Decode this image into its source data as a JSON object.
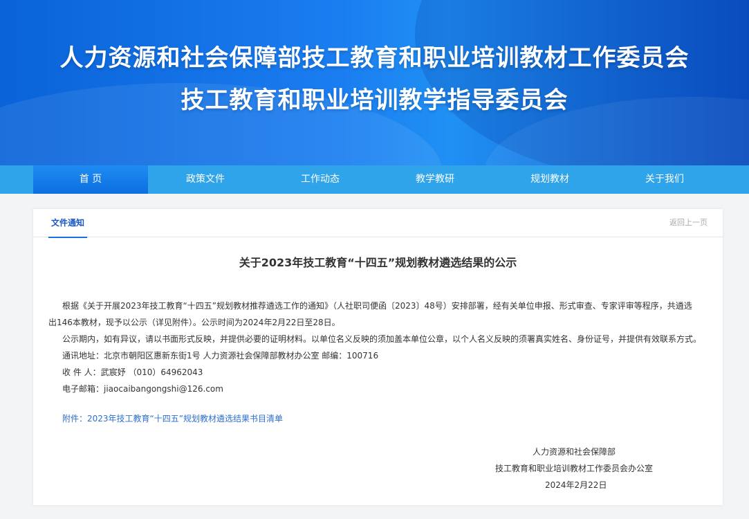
{
  "header": {
    "title_line1": "人力资源和社会保障部技工教育和职业培训教材工作委员会",
    "title_line2": "技工教育和职业培训教学指导委员会"
  },
  "nav": {
    "items": [
      "首 页",
      "政策文件",
      "工作动态",
      "教学教研",
      "规划教材",
      "关于我们"
    ],
    "active": "首 页"
  },
  "article": {
    "tab_label": "文件通知",
    "back_label": "返回上一页",
    "title": "关于2023年技工教育“十四五”规划教材遴选结果的公示",
    "para1_line1": "根据《关于开展2023年技工教育“十四五”规划教材推荐遴选工作的通知》（人社职司便函〔2023〕48号）安排部署，经有关单位申报、形式审查、专家评审等程序，共遴选",
    "para1_line2": "出146本教材，现予以公示（详见附件）。公示时间为2024年2月22日至28日。",
    "para2": "公示期内，如有异议，请以书面形式反映，并提供必要的证明材料。以单位名义反映的须加盖本单位公章，以个人名义反映的须署真实姓名、身份证号，并提供有效联系方式。",
    "address": "通讯地址：北京市朝阳区惠新东街1号 人力资源社会保障部教材办公室  邮编：100716",
    "recipient": "收 件 人：武宸妤 （010）64962043",
    "email": "电子邮箱：jiaocaibangongshi@126.com",
    "attachment": "附件：2023年技工教育“十四五”规划教材遴选结果书目清单",
    "sign_org1": "人力资源和社会保障部",
    "sign_org2": "技工教育和职业培训教材工作委员会办公室",
    "sign_date": "2024年2月22日"
  },
  "colors": {
    "nav_bg": "#2fa4ea",
    "nav_active": "#0b6fe0",
    "link": "#2d6fd0"
  }
}
